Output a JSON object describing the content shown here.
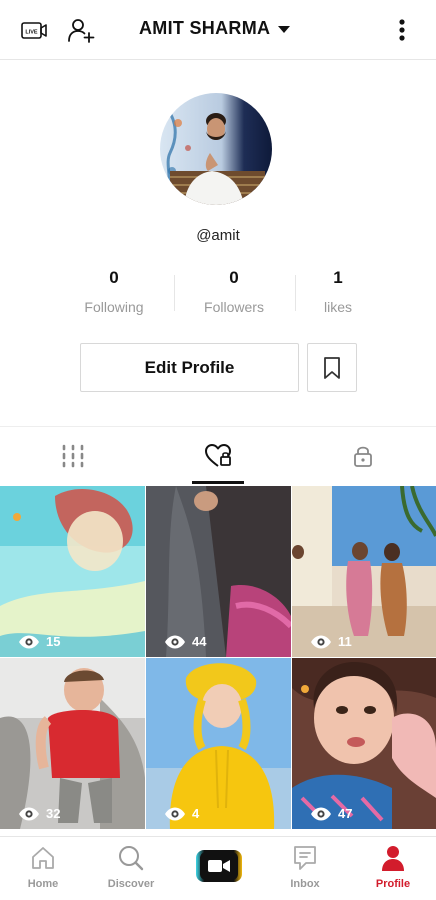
{
  "header": {
    "title": "AMIT SHARMA",
    "icons": [
      "live-icon",
      "add-user-icon",
      "caret-down-icon",
      "more-vertical-icon"
    ]
  },
  "profile": {
    "handle": "@amit",
    "stats": [
      {
        "value": "0",
        "label": "Following"
      },
      {
        "value": "0",
        "label": "Followers"
      },
      {
        "value": "1",
        "label": "likes"
      }
    ],
    "edit_label": "Edit Profile"
  },
  "tabs": {
    "items": [
      "grid-icon",
      "liked-icon",
      "lock-icon"
    ],
    "active_index": 1
  },
  "videos": [
    {
      "views": "15"
    },
    {
      "views": "44"
    },
    {
      "views": "11"
    },
    {
      "views": "32"
    },
    {
      "views": "4"
    },
    {
      "views": "47"
    }
  ],
  "bottom_nav": {
    "items": [
      {
        "label": "Home",
        "icon": "home-icon"
      },
      {
        "label": "Discover",
        "icon": "search-icon"
      },
      {
        "label": "",
        "icon": "video-camera-icon"
      },
      {
        "label": "Inbox",
        "icon": "inbox-icon"
      },
      {
        "label": "Profile",
        "icon": "profile-icon"
      }
    ],
    "active_label": "Profile",
    "accent_color": "#d21c2c"
  }
}
